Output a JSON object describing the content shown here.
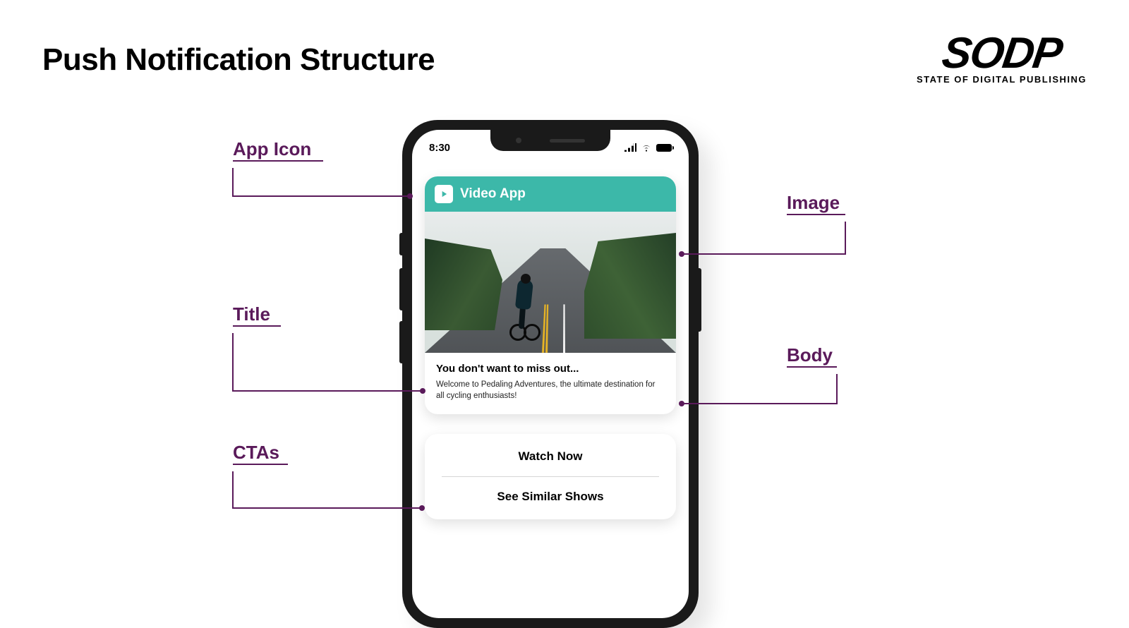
{
  "page": {
    "title": "Push Notification Structure"
  },
  "brand": {
    "name": "SODP",
    "tagline": "STATE OF DIGITAL PUBLISHING"
  },
  "phone": {
    "status_time": "8:30"
  },
  "notification": {
    "app_name": "Video App",
    "title": "You don't want to miss out...",
    "body": "Welcome to Pedaling Adventures, the ultimate destination for all cycling enthusiasts!",
    "image_description": "cyclist riding on an open tree-lined road"
  },
  "ctas": {
    "primary": "Watch Now",
    "secondary": "See Similar Shows"
  },
  "callouts": {
    "app_icon": "App Icon",
    "title": "Title",
    "ctas": "CTAs",
    "image": "Image",
    "body": "Body"
  },
  "colors": {
    "accent": "#5a1a5a",
    "notif_header": "#3cb8a9"
  }
}
